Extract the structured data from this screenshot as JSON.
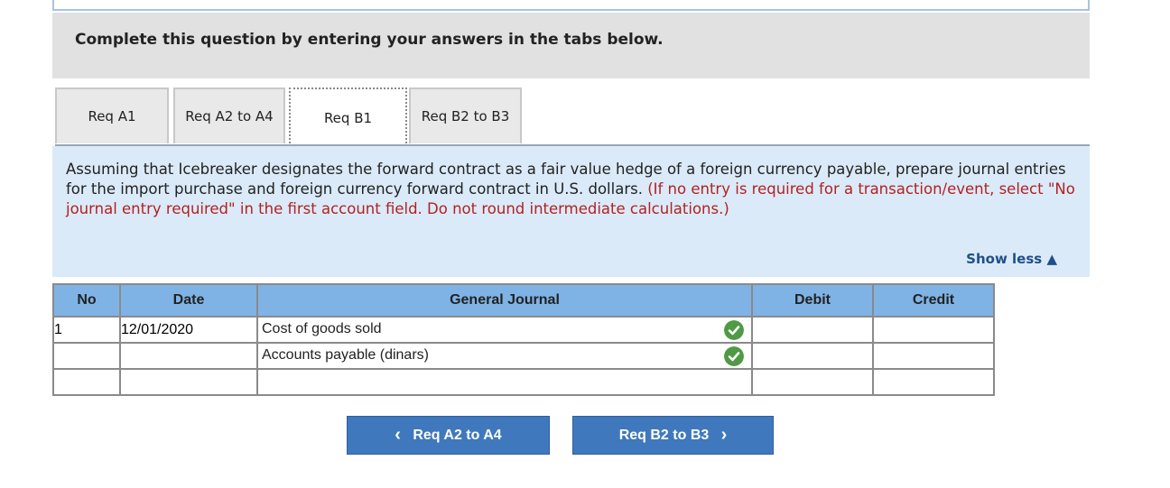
{
  "instructions": "Complete this question by entering your answers in the tabs below.",
  "tabs": [
    {
      "label": "Req A1",
      "active": false
    },
    {
      "label": "Req A2 to A4",
      "active": false
    },
    {
      "label": "Req B1",
      "active": true
    },
    {
      "label": "Req B2 to B3",
      "active": false
    }
  ],
  "question": {
    "text": "Assuming that Icebreaker designates the forward contract as a fair value hedge of a foreign currency payable, prepare journal entries for the import purchase and foreign currency forward contract in U.S. dollars.",
    "note": "(If no entry is required for a transaction/event, select \"No journal entry required\" in the first account field. Do not round intermediate calculations.)"
  },
  "show_less": "Show less",
  "journal": {
    "headers": {
      "no": "No",
      "date": "Date",
      "general_journal": "General Journal",
      "debit": "Debit",
      "credit": "Credit"
    },
    "rows": [
      {
        "no": "1",
        "date": "12/01/2020",
        "account": "Cost of goods sold",
        "debit": "",
        "credit": "",
        "status": "correct"
      },
      {
        "no": "",
        "date": "",
        "account": "Accounts payable (dinars)",
        "debit": "",
        "credit": "",
        "status": "correct"
      },
      {
        "no": "",
        "date": "",
        "account": "",
        "debit": "",
        "credit": "",
        "status": ""
      }
    ]
  },
  "nav": {
    "prev_label": "Req A2 to A4",
    "next_label": "Req B2 to B3"
  },
  "colors": {
    "header_blue": "#7fb3e5",
    "button_blue": "#3f78bd",
    "check_green": "#4f9a44",
    "note_red": "#b22222",
    "panel_blue": "#dbeaf8"
  }
}
